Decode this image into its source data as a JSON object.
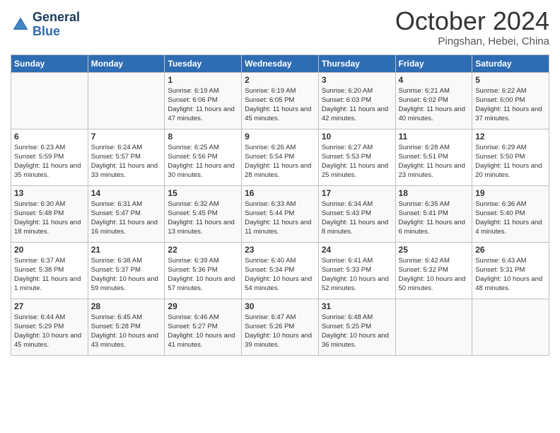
{
  "header": {
    "logo_line1": "General",
    "logo_line2": "Blue",
    "month_year": "October 2024",
    "location": "Pingshan, Hebei, China"
  },
  "columns": [
    "Sunday",
    "Monday",
    "Tuesday",
    "Wednesday",
    "Thursday",
    "Friday",
    "Saturday"
  ],
  "weeks": [
    [
      {
        "day": "",
        "info": ""
      },
      {
        "day": "",
        "info": ""
      },
      {
        "day": "1",
        "info": "Sunrise: 6:19 AM\nSunset: 6:06 PM\nDaylight: 11 hours and 47 minutes."
      },
      {
        "day": "2",
        "info": "Sunrise: 6:19 AM\nSunset: 6:05 PM\nDaylight: 11 hours and 45 minutes."
      },
      {
        "day": "3",
        "info": "Sunrise: 6:20 AM\nSunset: 6:03 PM\nDaylight: 11 hours and 42 minutes."
      },
      {
        "day": "4",
        "info": "Sunrise: 6:21 AM\nSunset: 6:02 PM\nDaylight: 11 hours and 40 minutes."
      },
      {
        "day": "5",
        "info": "Sunrise: 6:22 AM\nSunset: 6:00 PM\nDaylight: 11 hours and 37 minutes."
      }
    ],
    [
      {
        "day": "6",
        "info": "Sunrise: 6:23 AM\nSunset: 5:59 PM\nDaylight: 11 hours and 35 minutes."
      },
      {
        "day": "7",
        "info": "Sunrise: 6:24 AM\nSunset: 5:57 PM\nDaylight: 11 hours and 33 minutes."
      },
      {
        "day": "8",
        "info": "Sunrise: 6:25 AM\nSunset: 5:56 PM\nDaylight: 11 hours and 30 minutes."
      },
      {
        "day": "9",
        "info": "Sunrise: 6:26 AM\nSunset: 5:54 PM\nDaylight: 11 hours and 28 minutes."
      },
      {
        "day": "10",
        "info": "Sunrise: 6:27 AM\nSunset: 5:53 PM\nDaylight: 11 hours and 25 minutes."
      },
      {
        "day": "11",
        "info": "Sunrise: 6:28 AM\nSunset: 5:51 PM\nDaylight: 11 hours and 23 minutes."
      },
      {
        "day": "12",
        "info": "Sunrise: 6:29 AM\nSunset: 5:50 PM\nDaylight: 11 hours and 20 minutes."
      }
    ],
    [
      {
        "day": "13",
        "info": "Sunrise: 6:30 AM\nSunset: 5:48 PM\nDaylight: 11 hours and 18 minutes."
      },
      {
        "day": "14",
        "info": "Sunrise: 6:31 AM\nSunset: 5:47 PM\nDaylight: 11 hours and 16 minutes."
      },
      {
        "day": "15",
        "info": "Sunrise: 6:32 AM\nSunset: 5:45 PM\nDaylight: 11 hours and 13 minutes."
      },
      {
        "day": "16",
        "info": "Sunrise: 6:33 AM\nSunset: 5:44 PM\nDaylight: 11 hours and 11 minutes."
      },
      {
        "day": "17",
        "info": "Sunrise: 6:34 AM\nSunset: 5:43 PM\nDaylight: 11 hours and 8 minutes."
      },
      {
        "day": "18",
        "info": "Sunrise: 6:35 AM\nSunset: 5:41 PM\nDaylight: 11 hours and 6 minutes."
      },
      {
        "day": "19",
        "info": "Sunrise: 6:36 AM\nSunset: 5:40 PM\nDaylight: 11 hours and 4 minutes."
      }
    ],
    [
      {
        "day": "20",
        "info": "Sunrise: 6:37 AM\nSunset: 5:38 PM\nDaylight: 11 hours and 1 minute."
      },
      {
        "day": "21",
        "info": "Sunrise: 6:38 AM\nSunset: 5:37 PM\nDaylight: 10 hours and 59 minutes."
      },
      {
        "day": "22",
        "info": "Sunrise: 6:39 AM\nSunset: 5:36 PM\nDaylight: 10 hours and 57 minutes."
      },
      {
        "day": "23",
        "info": "Sunrise: 6:40 AM\nSunset: 5:34 PM\nDaylight: 10 hours and 54 minutes."
      },
      {
        "day": "24",
        "info": "Sunrise: 6:41 AM\nSunset: 5:33 PM\nDaylight: 10 hours and 52 minutes."
      },
      {
        "day": "25",
        "info": "Sunrise: 6:42 AM\nSunset: 5:32 PM\nDaylight: 10 hours and 50 minutes."
      },
      {
        "day": "26",
        "info": "Sunrise: 6:43 AM\nSunset: 5:31 PM\nDaylight: 10 hours and 48 minutes."
      }
    ],
    [
      {
        "day": "27",
        "info": "Sunrise: 6:44 AM\nSunset: 5:29 PM\nDaylight: 10 hours and 45 minutes."
      },
      {
        "day": "28",
        "info": "Sunrise: 6:45 AM\nSunset: 5:28 PM\nDaylight: 10 hours and 43 minutes."
      },
      {
        "day": "29",
        "info": "Sunrise: 6:46 AM\nSunset: 5:27 PM\nDaylight: 10 hours and 41 minutes."
      },
      {
        "day": "30",
        "info": "Sunrise: 6:47 AM\nSunset: 5:26 PM\nDaylight: 10 hours and 39 minutes."
      },
      {
        "day": "31",
        "info": "Sunrise: 6:48 AM\nSunset: 5:25 PM\nDaylight: 10 hours and 36 minutes."
      },
      {
        "day": "",
        "info": ""
      },
      {
        "day": "",
        "info": ""
      }
    ]
  ]
}
